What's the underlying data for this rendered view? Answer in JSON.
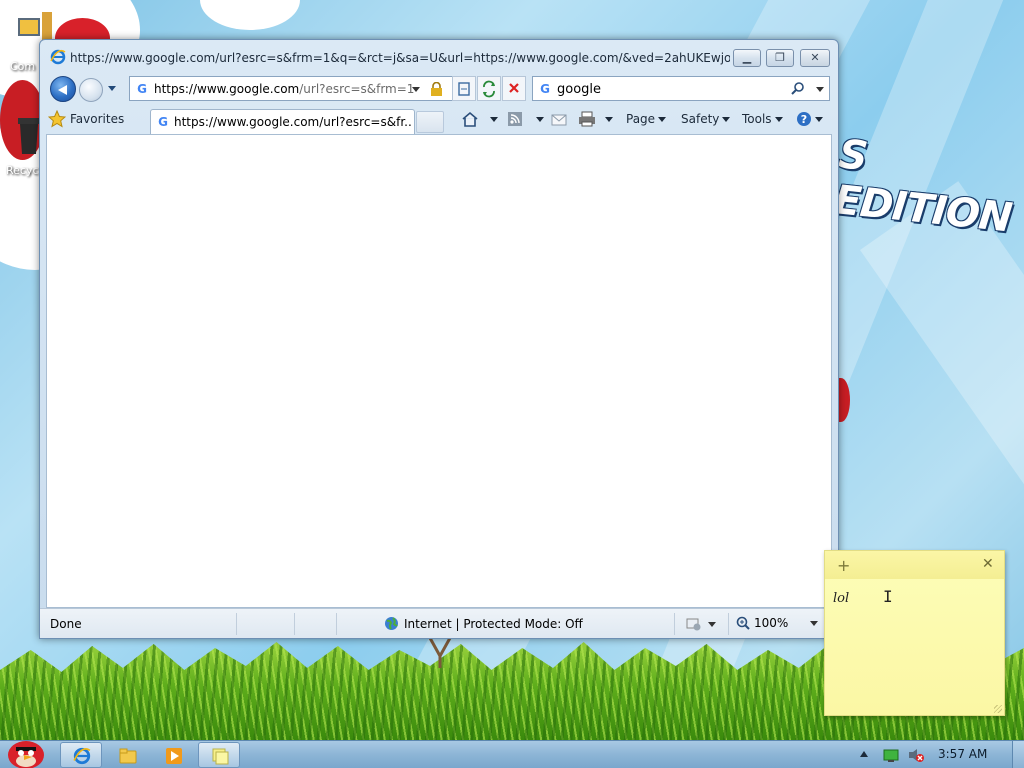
{
  "desktop": {
    "edition_text": "S EDITION",
    "icon_computer_label": "Com",
    "icon_recycle_label": "Recyc"
  },
  "window": {
    "title": "https://www.google.com/url?esrc=s&frm=1&q=&rct=j&sa=U&url=https://www.google.com/&ved=2ahUKEwjo ...",
    "address_bold": "https://www.google.com",
    "address_dim": "/url?esrc=s&frm=1",
    "search_value": "google",
    "tab_label": "https://www.google.com/url?esrc=s&fr...",
    "favorites_label": "Favorites",
    "menu": {
      "page": "Page",
      "safety": "Safety",
      "tools": "Tools"
    },
    "status": {
      "done": "Done",
      "zone": "Internet | Protected Mode: Off",
      "zoom": "100%"
    }
  },
  "sticky_note": {
    "text": "lol"
  },
  "taskbar": {
    "clock": "3:57 AM"
  },
  "colors": {
    "accent": "#2d6fc4",
    "sticky": "#fbf7a4",
    "close_red": "#d22"
  }
}
